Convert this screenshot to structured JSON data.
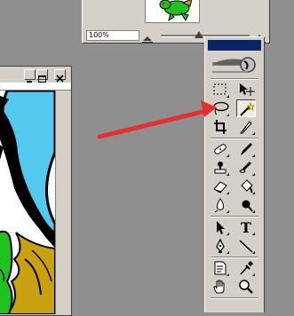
{
  "navigator": {
    "zoom_value": "100%"
  },
  "document": {
    "title": ""
  },
  "toolbox": {
    "tools": [
      "rectangular-marquee-tool",
      "move-tool",
      "lasso-tool",
      "magic-wand-tool",
      "crop-tool",
      "slice-tool",
      "healing-brush-tool",
      "brush-tool",
      "clone-stamp-tool",
      "history-brush-tool",
      "eraser-tool",
      "paint-bucket-tool",
      "blur-tool",
      "burn-tool",
      "path-selection-tool",
      "type-tool",
      "pen-tool",
      "line-tool",
      "notes-tool",
      "eyedropper-tool",
      "hand-tool",
      "zoom-tool"
    ],
    "selected_tool": "magic-wand-tool"
  },
  "annotation": {
    "arrow_color": "#e53030",
    "points_to": "lasso-tool"
  },
  "colors": {
    "background": "#8f8f8f",
    "panel": "#d4d0c8",
    "titlebar_active": "#0a246a",
    "art_blue": "#55c8f0",
    "art_green": "#1fc21f",
    "art_gold": "#c8a010"
  }
}
